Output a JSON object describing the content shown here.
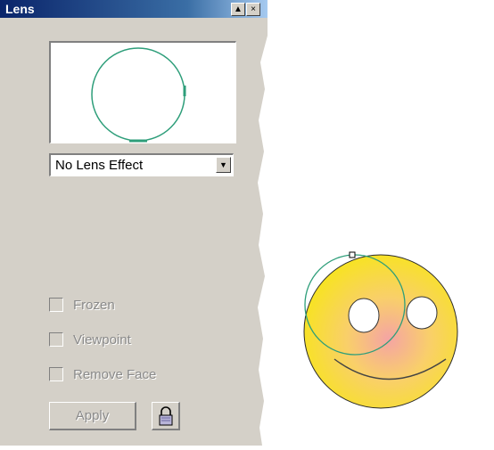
{
  "window": {
    "title": "Lens",
    "minimize_glyph": "▲",
    "close_glyph": "×"
  },
  "lens_type": {
    "selected": "No Lens Effect",
    "arrow_glyph": "▼"
  },
  "options": {
    "frozen": "Frozen",
    "viewpoint": "Viewpoint",
    "remove_face": "Remove Face"
  },
  "buttons": {
    "apply": "Apply"
  },
  "icons": {
    "lock": "lock-icon"
  },
  "colors": {
    "titlebar": "#0a246a",
    "panel": "#d4d0c8",
    "lens_circle": "#2e9e7a",
    "smiley_yellow": "#f7e51b",
    "smiley_pink": "#f4a4a4"
  }
}
